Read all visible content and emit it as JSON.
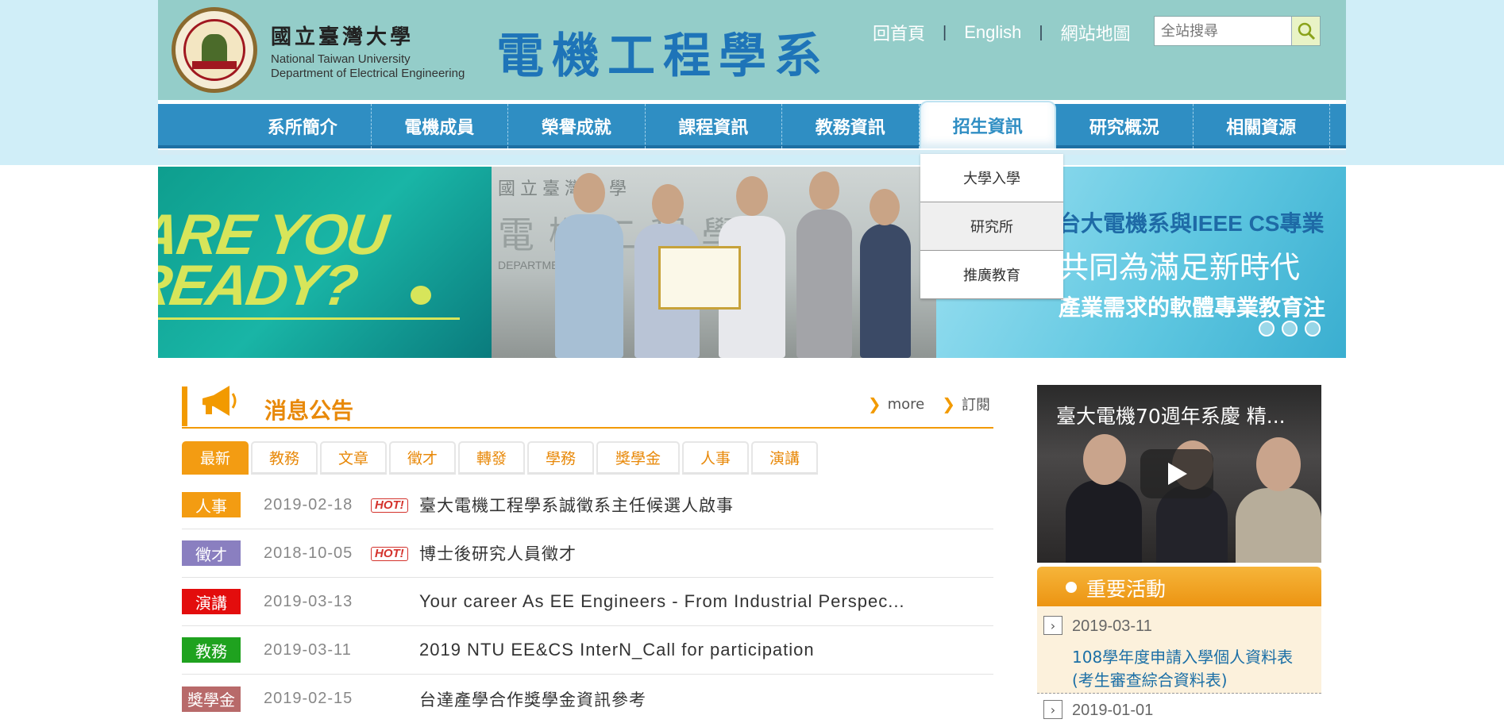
{
  "header": {
    "univ_cn": "國立臺灣大學",
    "univ_en_1": "National Taiwan University",
    "univ_en_2": "Department of Electrical Engineering",
    "dept_cn": "電機工程學系",
    "links": {
      "home": "回首頁",
      "english": "English",
      "sitemap": "網站地圖"
    },
    "search_placeholder": "全站搜尋"
  },
  "nav": {
    "items": [
      "系所簡介",
      "電機成員",
      "榮譽成就",
      "課程資訊",
      "教務資訊",
      "招生資訊",
      "研究概況",
      "相關資源"
    ],
    "active_index": 5,
    "dropdown": [
      "大學入學",
      "研究所",
      "推廣教育"
    ]
  },
  "banner": {
    "left_text": "ARE YOU READY?",
    "wall_text_1": "國立臺灣大學",
    "wall_text_2": "電機工程學",
    "wall_text_3": "DEPARTMENT",
    "right_line_1": "台大電機系與IEEE CS專業",
    "right_line_2": "共同為滿足新時代",
    "right_line_3": "產業需求的軟體專業教育注"
  },
  "news": {
    "title": "消息公告",
    "more_label": "more",
    "subscribe_label": "訂閱",
    "tabs": [
      "最新",
      "教務",
      "文章",
      "徵才",
      "轉發",
      "學務",
      "獎學金",
      "人事",
      "演講"
    ],
    "hot_label": "HOT!",
    "items": [
      {
        "category": "人事",
        "color": "#f39c12",
        "date": "2019-02-18",
        "hot": true,
        "title": "臺大電機工程學系誠徵系主任候選人啟事"
      },
      {
        "category": "徵才",
        "color": "#8a7fc0",
        "date": "2018-10-05",
        "hot": true,
        "title": "博士後研究人員徵才"
      },
      {
        "category": "演講",
        "color": "#e30d0d",
        "date": "2019-03-13",
        "hot": false,
        "title": "Your career As EE Engineers - From Industrial Perspec..."
      },
      {
        "category": "教務",
        "color": "#1fa21f",
        "date": "2019-03-11",
        "hot": false,
        "title": "2019 NTU EE&CS InterN_Call for participation"
      },
      {
        "category": "獎學金",
        "color": "#b86a6a",
        "date": "2019-02-15",
        "hot": false,
        "title": "台達產學合作獎學金資訊參考"
      }
    ]
  },
  "video": {
    "title": "臺大電機70週年系慶 精..."
  },
  "events": {
    "title": "重要活動",
    "items": [
      {
        "date": "2019-03-11",
        "text": "108學年度申請入學個人資料表(考生審查綜合資料表)"
      },
      {
        "date": "2019-01-01"
      }
    ]
  }
}
